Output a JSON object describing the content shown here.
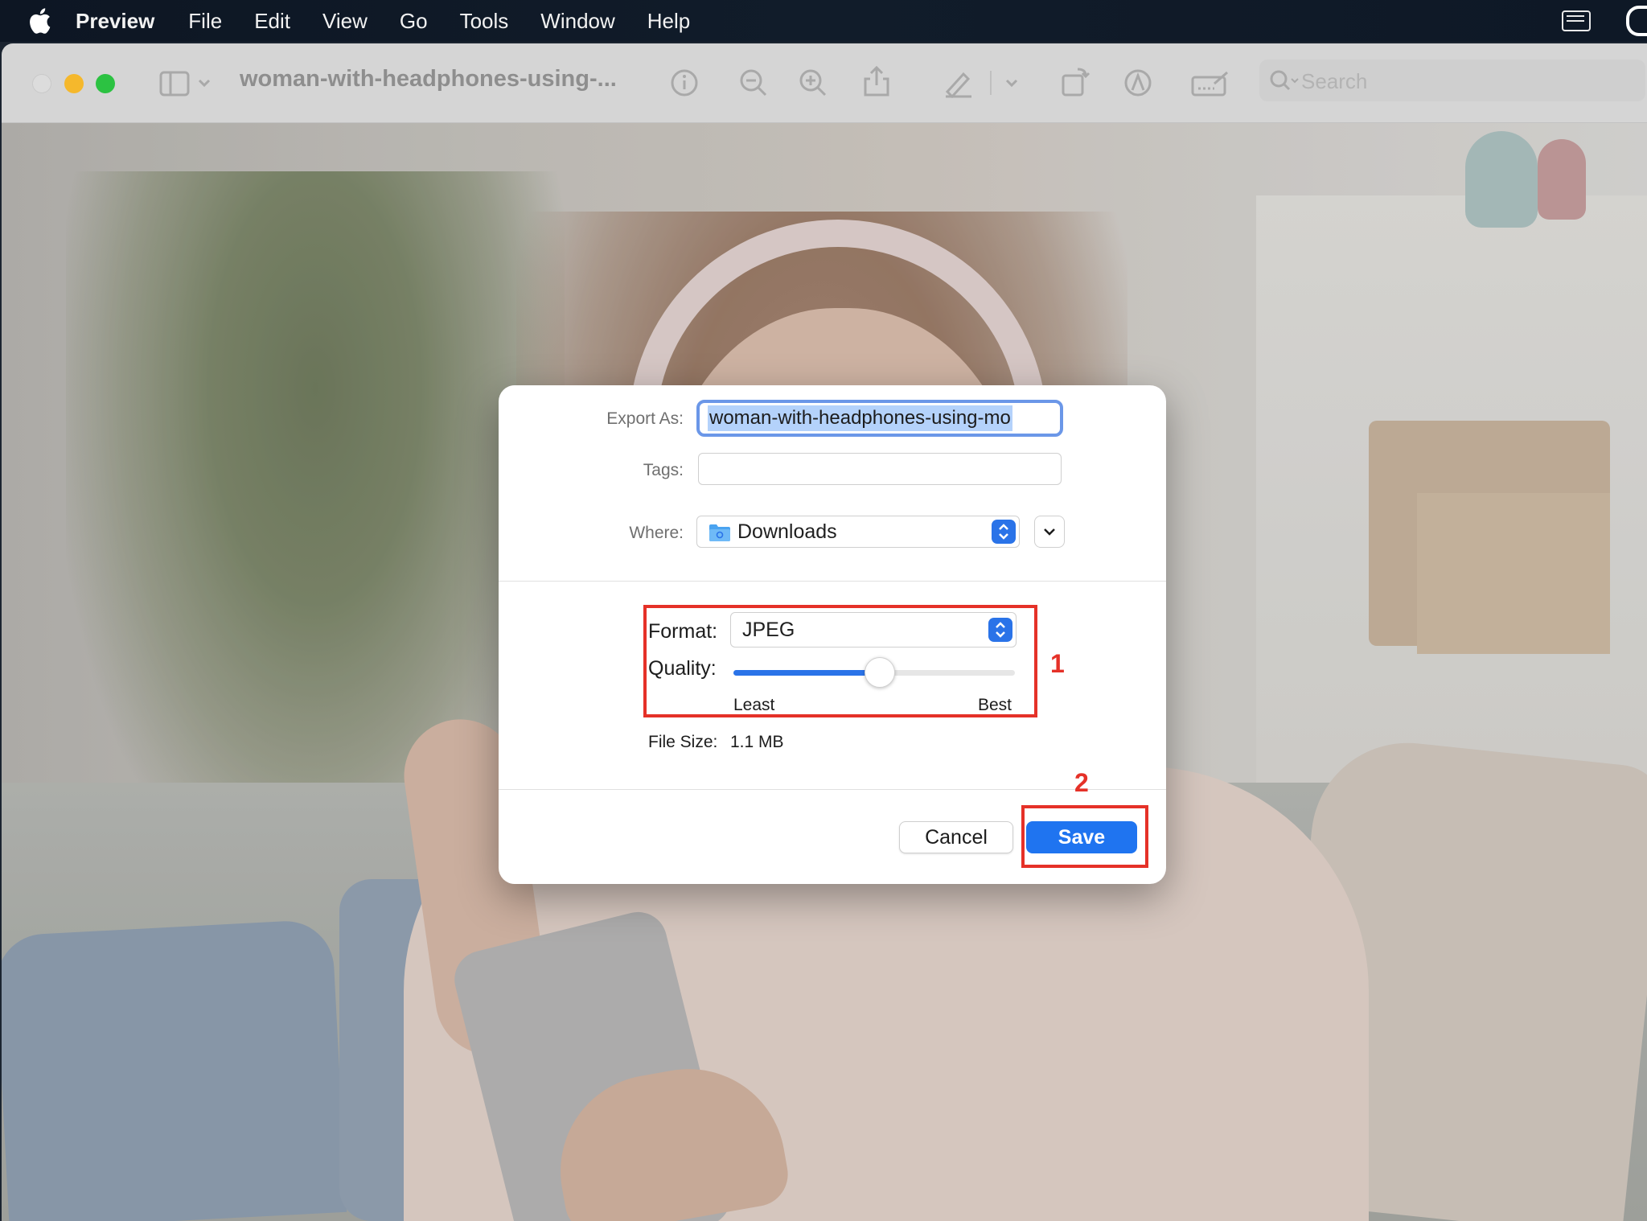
{
  "menubar": {
    "app_name": "Preview",
    "items": [
      "File",
      "Edit",
      "View",
      "Go",
      "Tools",
      "Window",
      "Help"
    ],
    "icons": [
      "apple-logo-icon",
      "keyboard-input-icon",
      "status-icon"
    ]
  },
  "window": {
    "title": "woman-with-headphones-using-...",
    "search_placeholder": "Search",
    "toolbar_icons": [
      "sidebar-icon",
      "info-icon",
      "zoom-out-icon",
      "zoom-in-icon",
      "share-icon",
      "markup-pen-icon",
      "rotate-icon",
      "annotate-icon",
      "signature-icon",
      "search-icon"
    ]
  },
  "export_dialog": {
    "export_as_label": "Export As:",
    "export_as_value": "woman-with-headphones-using-mo",
    "tags_label": "Tags:",
    "tags_value": "",
    "where_label": "Where:",
    "where_value": "Downloads",
    "format_label": "Format:",
    "format_value": "JPEG",
    "quality_label": "Quality:",
    "quality_level": 0.52,
    "quality_min_label": "Least",
    "quality_max_label": "Best",
    "file_size_label": "File Size:",
    "file_size_value": "1.1 MB",
    "cancel_label": "Cancel",
    "save_label": "Save"
  },
  "annotations": {
    "step1": "1",
    "step2": "2",
    "color": "#e53128"
  },
  "colors": {
    "accent": "#1f74f0",
    "menubar": "#0d1623"
  }
}
